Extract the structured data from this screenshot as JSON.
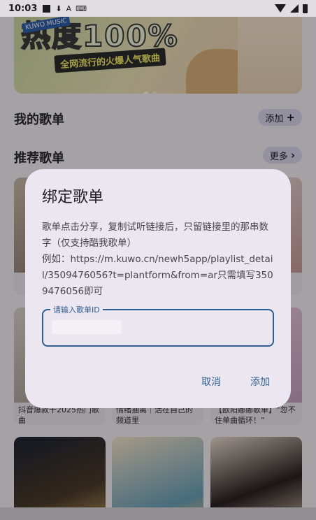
{
  "status_bar": {
    "time": "10:03"
  },
  "banner": {
    "brand": "KUWO MUSIC",
    "headline": "热度100%",
    "subtitle": "全网流行的火爆人气歌曲"
  },
  "my_playlists": {
    "title": "我的歌单",
    "add_label": "添加"
  },
  "recommended": {
    "title": "推荐歌单",
    "more_label": "更多",
    "cards": [
      {
        "caption": ""
      },
      {
        "caption": ""
      },
      {
        "caption": ""
      },
      {
        "caption": "抖音爆款十2025热门歌曲"
      },
      {
        "caption": "情绪抽离｜活在自己的频道里"
      },
      {
        "caption": "【欧阳娜娜歌单】“忽不住单曲循环！”"
      },
      {
        "caption": ""
      },
      {
        "caption": ""
      },
      {
        "caption": ""
      }
    ]
  },
  "dialog": {
    "title": "绑定歌单",
    "body": "歌单点击分享，复制试听链接后，只留链接里的那串数字（仅支持酷我歌单）\n例如：https://m.kuwo.cn/newh5app/playlist_detail/3509476056?t=plantform&from=ar只需填写3509476056即可",
    "field_label": "请输入歌单ID",
    "cancel_label": "取消",
    "confirm_label": "添加"
  },
  "colors": {
    "accent": "#2f5e8f",
    "dialog_bg": "#ece6f0"
  }
}
